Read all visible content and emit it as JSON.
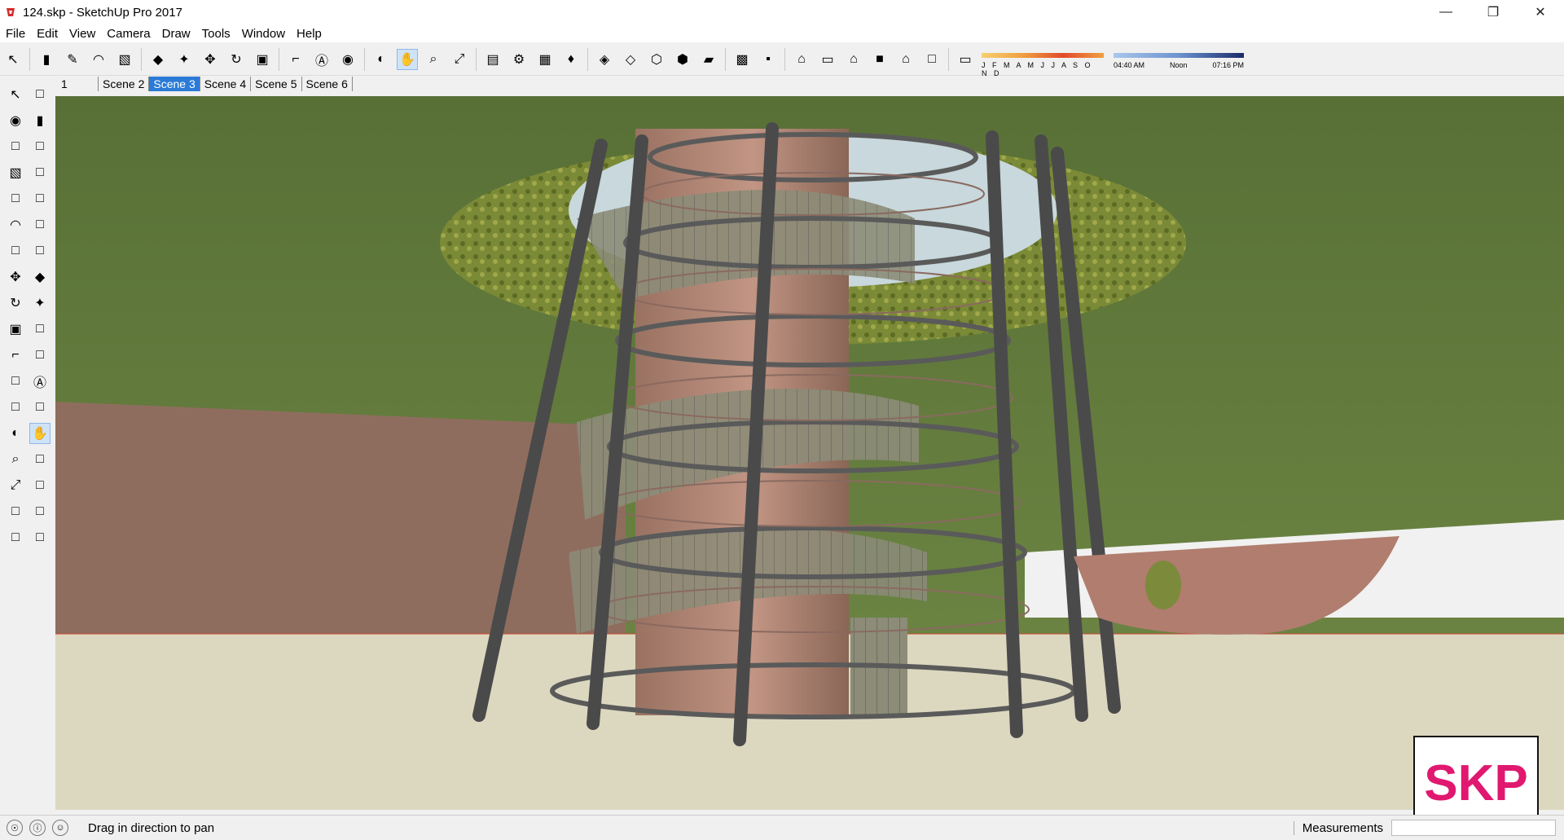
{
  "window": {
    "title": "124.skp - SketchUp Pro 2017",
    "controls": [
      "minimize",
      "restore",
      "close"
    ]
  },
  "menu": [
    "File",
    "Edit",
    "View",
    "Camera",
    "Draw",
    "Tools",
    "Window",
    "Help"
  ],
  "toolbar": {
    "icons": [
      "select-icon",
      "eraser-icon",
      "pencil-line-icon",
      "arc-icon",
      "rectangle-icon",
      "push-pull-icon",
      "follow-me-icon",
      "move-icon",
      "rotate-icon",
      "scale-icon",
      "tape-measure-icon",
      "text-icon",
      "paint-bucket-icon",
      "orbit-icon",
      "pan-icon",
      "zoom-icon",
      "zoom-extents-icon",
      "3d-warehouse-icon",
      "extension-warehouse-icon",
      "layout-icon",
      "ruby-icon",
      "xray-icon",
      "back-edges-icon",
      "wireframe-icon",
      "hidden-line-icon",
      "shaded-icon",
      "shaded-textures-icon",
      "monochrome-icon",
      "iso-view-icon",
      "top-view-icon",
      "front-view-icon",
      "right-view-icon",
      "back-view-icon",
      "left-view-icon",
      "shadows-icon"
    ],
    "active": "pan-icon",
    "shadow_months": "J F M A M J J A S O N D",
    "time_start": "04:40 AM",
    "time_mid": "Noon",
    "time_end": "07:16 PM"
  },
  "scenes": {
    "tabs": [
      "1",
      "Scene 2",
      "Scene 3",
      "Scene 4",
      "Scene 5",
      "Scene 6"
    ],
    "active": "Scene 3"
  },
  "left_tools": [
    [
      "select-icon",
      "component-icon"
    ],
    [
      "paint-bucket-icon",
      "eraser-icon"
    ],
    [
      "pencil-icon",
      "freehand-icon"
    ],
    [
      "rectangle-icon",
      "rotated-rectangle-icon"
    ],
    [
      "circle-icon",
      "polygon-icon"
    ],
    [
      "arc-icon",
      "two-point-arc-icon"
    ],
    [
      "three-point-arc-icon",
      "pie-icon"
    ],
    [
      "move-icon",
      "push-pull-icon"
    ],
    [
      "rotate-icon",
      "follow-me-icon"
    ],
    [
      "scale-icon",
      "offset-icon"
    ],
    [
      "tape-measure-icon",
      "dimension-icon"
    ],
    [
      "protractor-icon",
      "text-icon"
    ],
    [
      "axes-icon",
      "3d-text-icon"
    ],
    [
      "orbit-icon",
      "pan-icon"
    ],
    [
      "zoom-icon",
      "zoom-window-icon"
    ],
    [
      "zoom-extents-icon",
      "previous-view-icon"
    ],
    [
      "position-camera-icon",
      "look-around-icon"
    ],
    [
      "walk-icon",
      "section-plane-icon"
    ]
  ],
  "status": {
    "message": "Drag in direction to pan",
    "measurements_label": "Measurements",
    "measurements_value": ""
  },
  "watermark": "SKP",
  "colors": {
    "sky": "#5f7a3a",
    "ground": "#dcd8c0",
    "wall": "#8f6d5e",
    "tower": "#b88b7a",
    "frame": "#555555",
    "active_tab": "#2a7ad6",
    "logo": "#e0186f"
  }
}
